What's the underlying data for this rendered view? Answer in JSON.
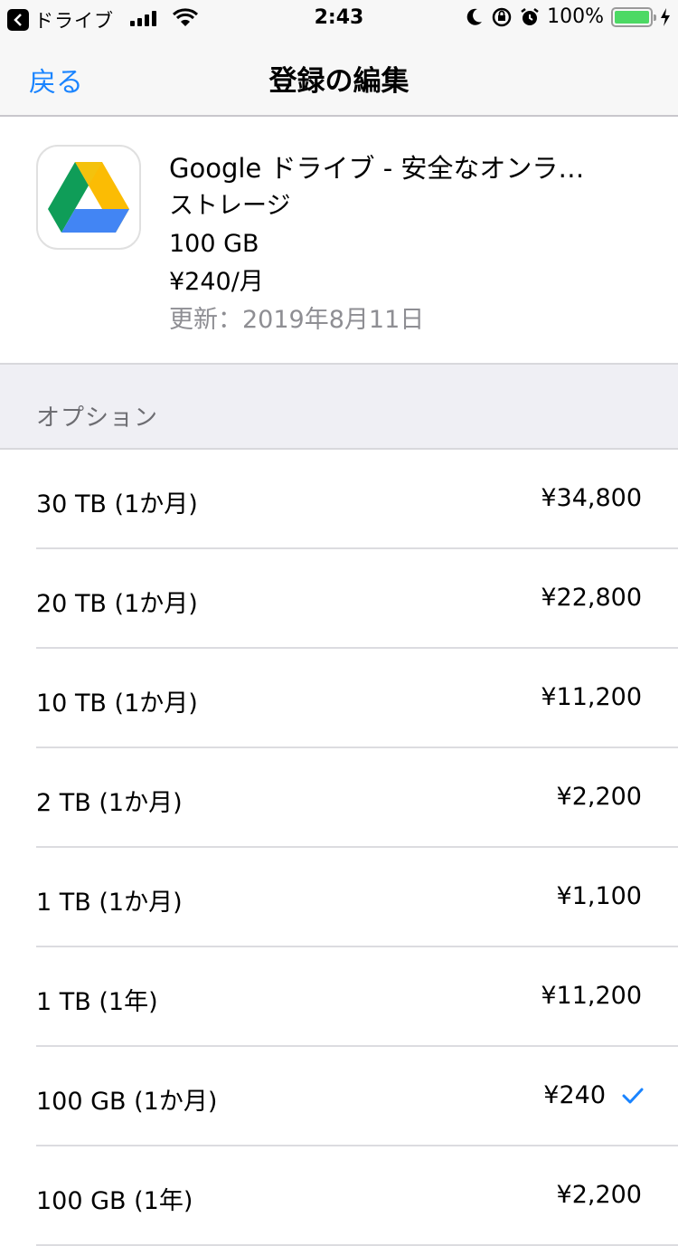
{
  "status_bar": {
    "back_app": "ドライブ",
    "time": "2:43",
    "battery": "100%"
  },
  "nav": {
    "back": "戻る",
    "title": "登録の編集"
  },
  "subscription": {
    "name": "Google ドライブ - 安全なオンラ…",
    "type": "ストレージ",
    "plan": "100 GB",
    "price": "¥240/月",
    "renewal": "更新：2019年8月11日"
  },
  "options_section": {
    "header": "オプション",
    "items": [
      {
        "label": "30 TB (1か月)",
        "price": "¥34,800",
        "selected": false
      },
      {
        "label": "20 TB (1か月)",
        "price": "¥22,800",
        "selected": false
      },
      {
        "label": "10 TB (1か月)",
        "price": "¥11,200",
        "selected": false
      },
      {
        "label": "2 TB (1か月)",
        "price": "¥2,200",
        "selected": false
      },
      {
        "label": "1 TB (1か月)",
        "price": "¥1,100",
        "selected": false
      },
      {
        "label": "1 TB (1年)",
        "price": "¥11,200",
        "selected": false
      },
      {
        "label": "100 GB (1か月)",
        "price": "¥240",
        "selected": true
      },
      {
        "label": "100 GB (1年)",
        "price": "¥2,200",
        "selected": false
      }
    ]
  },
  "colors": {
    "accent": "#1a84ff",
    "battery": "#4cd964"
  }
}
